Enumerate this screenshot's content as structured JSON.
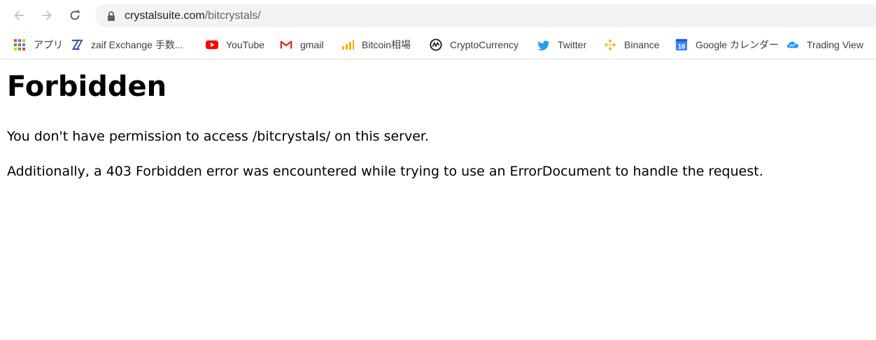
{
  "browser": {
    "url_domain": "crystalsuite.com",
    "url_path": "/bitcrystals/"
  },
  "bookmarks": [
    {
      "label": "アプリ",
      "icon": "apps-grid-icon"
    },
    {
      "label": "zaif Exchange 手数...",
      "icon": "zaif-icon"
    },
    {
      "label": "YouTube",
      "icon": "youtube-icon"
    },
    {
      "label": "gmail",
      "icon": "gmail-icon"
    },
    {
      "label": "Bitcoin相場",
      "icon": "signal-bars-icon"
    },
    {
      "label": "CryptoCurrency",
      "icon": "coinmarketcap-icon"
    },
    {
      "label": "Twitter",
      "icon": "twitter-icon"
    },
    {
      "label": "Binance",
      "icon": "binance-icon"
    },
    {
      "label": "Google カレンダー",
      "icon": "google-calendar-icon",
      "icon_text": "18"
    },
    {
      "label": "Trading View",
      "icon": "cloud-icon"
    }
  ],
  "page": {
    "title": "Forbidden",
    "message": "You don't have permission to access /bitcrystals/ on this server.",
    "additional": "Additionally, a 403 Forbidden error was encountered while trying to use an ErrorDocument to handle the request."
  },
  "colors": {
    "youtube": "#ff0000",
    "gmail": "#d93025",
    "twitter": "#1da1f2",
    "binance": "#f3ba2f",
    "calendar": "#4285f4",
    "tradingview": "#2196f3"
  }
}
